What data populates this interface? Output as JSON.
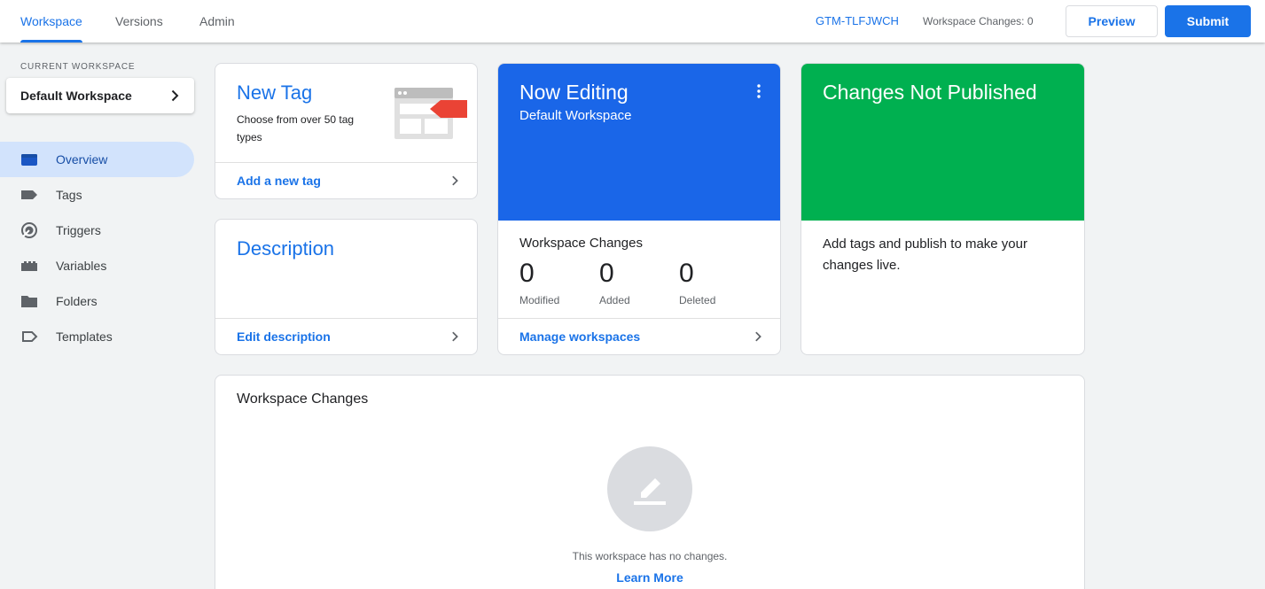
{
  "header": {
    "tabs": [
      {
        "label": "Workspace",
        "active": true
      },
      {
        "label": "Versions",
        "active": false
      },
      {
        "label": "Admin",
        "active": false
      }
    ],
    "container_id": "GTM-TLFJWCH",
    "workspace_changes": "Workspace Changes: 0",
    "preview_label": "Preview",
    "submit_label": "Submit"
  },
  "sidebar": {
    "current_workspace_label": "CURRENT WORKSPACE",
    "current_workspace": "Default Workspace",
    "items": [
      {
        "label": "Overview",
        "icon": "overview-icon",
        "active": true
      },
      {
        "label": "Tags",
        "icon": "tag-icon",
        "active": false
      },
      {
        "label": "Triggers",
        "icon": "trigger-icon",
        "active": false
      },
      {
        "label": "Variables",
        "icon": "variable-icon",
        "active": false
      },
      {
        "label": "Folders",
        "icon": "folder-icon",
        "active": false
      },
      {
        "label": "Templates",
        "icon": "template-icon",
        "active": false
      }
    ]
  },
  "new_tag_card": {
    "title": "New Tag",
    "subtitle": "Choose from over 50 tag types",
    "footer": "Add a new tag"
  },
  "description_card": {
    "title": "Description",
    "footer": "Edit description"
  },
  "editing_card": {
    "title": "Now Editing",
    "workspace": "Default Workspace",
    "changes_title": "Workspace Changes",
    "stats": [
      {
        "value": "0",
        "label": "Modified"
      },
      {
        "value": "0",
        "label": "Added"
      },
      {
        "value": "0",
        "label": "Deleted"
      }
    ],
    "footer": "Manage workspaces"
  },
  "not_published_card": {
    "title": "Changes Not Published",
    "body": "Add tags and publish to make your changes live."
  },
  "workspace_changes_panel": {
    "title": "Workspace Changes",
    "empty_text": "This workspace has no changes.",
    "learn_more": "Learn More"
  },
  "colors": {
    "accent": "#1a73e8",
    "editing_banner": "#1a66e8",
    "not_published_banner": "#00b050",
    "background": "#f1f3f4"
  }
}
